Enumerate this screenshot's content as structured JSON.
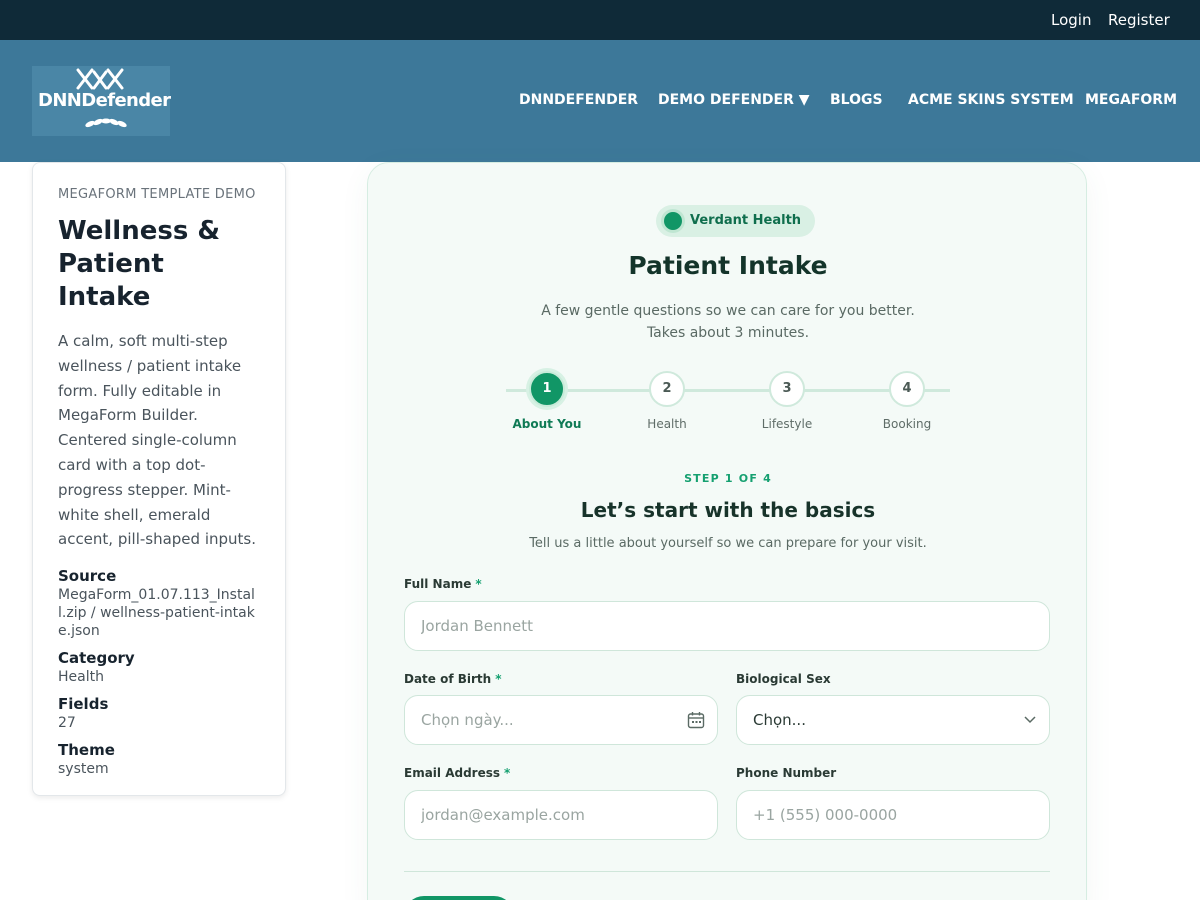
{
  "topbar": {
    "login": "Login",
    "register": "Register"
  },
  "brand": {
    "logo_text": "DNNDefender"
  },
  "nav": [
    {
      "label": "DNNDEFENDER"
    },
    {
      "label": "DEMO DEFENDER ▼"
    },
    {
      "label": "BLOGS"
    },
    {
      "label": "ACME SKINS SYSTEM"
    },
    {
      "label": "MEGAFORM"
    }
  ],
  "sidebar": {
    "eyebrow": "MEGAFORM TEMPLATE DEMO",
    "title": "Wellness & Patient Intake",
    "description": "A calm, soft multi-step wellness / patient intake form. Fully editable in MegaForm Builder. Centered single-column card with a top dot-progress stepper. Mint-white shell, emerald accent, pill-shaped inputs.",
    "meta": [
      {
        "label": "Source",
        "value": "MegaForm_01.07.113_Install.zip / wellness-patient-intake.json"
      },
      {
        "label": "Category",
        "value": "Health"
      },
      {
        "label": "Fields",
        "value": "27"
      },
      {
        "label": "Theme",
        "value": "system"
      }
    ]
  },
  "form": {
    "badge": "Verdant Health",
    "title": "Patient Intake",
    "subtitle_line1": "A few gentle questions so we can care for you better.",
    "subtitle_line2": "Takes about 3 minutes.",
    "steps": [
      {
        "number": "1",
        "label": "About You",
        "active": true
      },
      {
        "number": "2",
        "label": "Health",
        "active": false
      },
      {
        "number": "3",
        "label": "Lifestyle",
        "active": false
      },
      {
        "number": "4",
        "label": "Booking",
        "active": false
      }
    ],
    "step_counter": "STEP 1 OF 4",
    "section_title": "Let’s start with the basics",
    "section_subtitle": "Tell us a little about yourself so we can prepare for your visit.",
    "required_mark": "*",
    "fields": {
      "full_name": {
        "label": "Full Name",
        "placeholder": "Jordan Bennett"
      },
      "dob": {
        "label": "Date of Birth",
        "placeholder": "Chọn ngày..."
      },
      "sex": {
        "label": "Biological Sex",
        "value": "Chọn..."
      },
      "email": {
        "label": "Email Address",
        "placeholder": "jordan@example.com"
      },
      "phone": {
        "label": "Phone Number",
        "placeholder": "+1 (555) 000-0000"
      }
    },
    "next_label": ""
  },
  "colors": {
    "accent": "#119666",
    "topbar": "#0f2a38",
    "navbar": "#3d7899",
    "mint_shell": "#f4faf7"
  },
  "icons": {
    "dob": "calendar-icon",
    "sex": "chevron-down-icon"
  }
}
